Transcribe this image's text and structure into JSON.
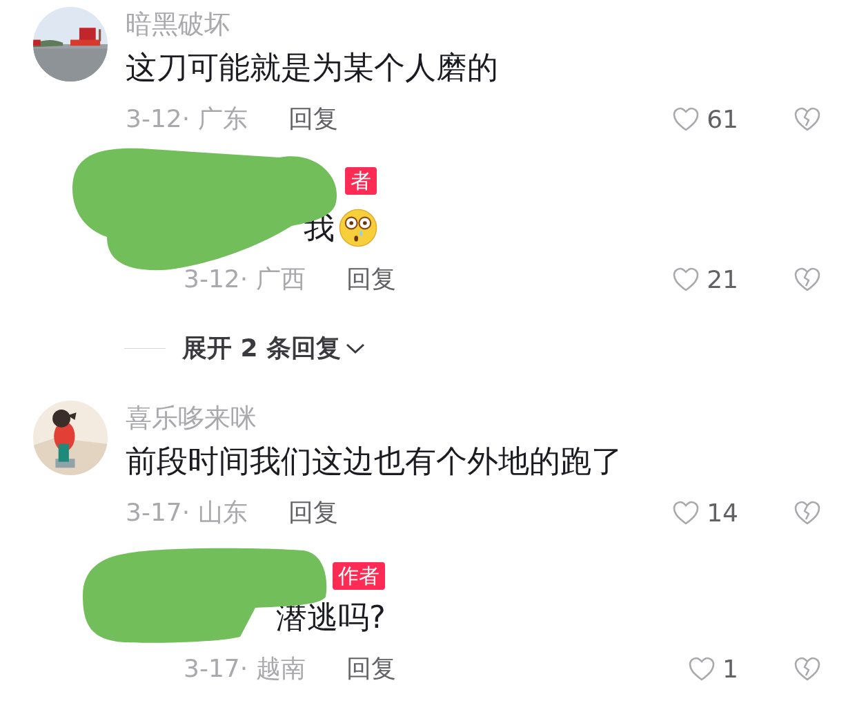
{
  "comments": [
    {
      "avatar": {
        "kind": "picture"
      },
      "username": "暗黑破坏",
      "text": "这刀可能就是为某个人磨的",
      "date": "3-12· 广东",
      "reply_label": "回复",
      "likes": "61",
      "liked": false,
      "replies": [
        {
          "redacted": true,
          "badge": "者",
          "text": "我",
          "emoji": true,
          "date": "3-12· 广西",
          "reply_label": "回复",
          "likes": "21",
          "liked": false
        }
      ],
      "expand": "展开 2 条回复"
    },
    {
      "avatar": {
        "kind": "picture"
      },
      "username": "喜乐哆来咪",
      "text": "前段时间我们这边也有个外地的跑了",
      "date": "3-17· 山东",
      "reply_label": "回复",
      "likes": "14",
      "liked": false,
      "replies": [
        {
          "redacted": true,
          "badge": "作者",
          "text": "潜逃吗?",
          "emoji": false,
          "date": "3-17· 越南",
          "reply_label": "回复",
          "likes": "1",
          "liked": false
        }
      ]
    }
  ]
}
